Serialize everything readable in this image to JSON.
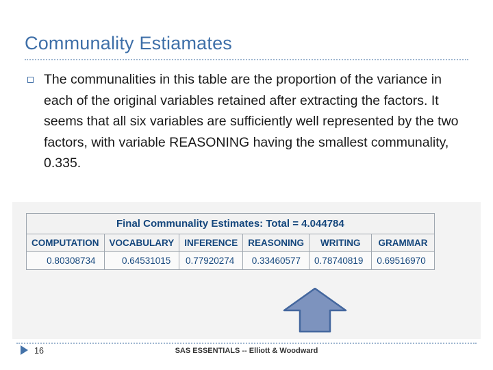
{
  "slide": {
    "title": "Communality Estiamates",
    "bullet": {
      "marker": "square-outline-bullet",
      "text": "The communalities in this table are the proportion of the variance in each of the original variables retained after extracting the factors. It seems that all six variables are sufficiently well represented by the two factors, with variable REASONING having the smallest communality, 0.335."
    },
    "table": {
      "caption": "Final Communality Estimates: Total = 4.044784",
      "headers": [
        "COMPUTATION",
        "VOCABULARY",
        "INFERENCE",
        "REASONING",
        "WRITING",
        "GRAMMAR"
      ],
      "values": [
        "0.80308734",
        "0.64531015",
        "0.77920274",
        "0.33460577",
        "0.78740819",
        "0.69516970"
      ]
    },
    "arrow": {
      "name": "up-arrow-callout",
      "color": "#44679E",
      "fill": "#7D93BE"
    },
    "footer": {
      "slide_number": "16",
      "center_text": "SAS ESSENTIALS -- Elliott & Woodward"
    },
    "colors": {
      "title": "#3E6FA8",
      "rule": "#9FB6D0",
      "table_text": "#15477D",
      "band": "#F3F3F3"
    }
  }
}
